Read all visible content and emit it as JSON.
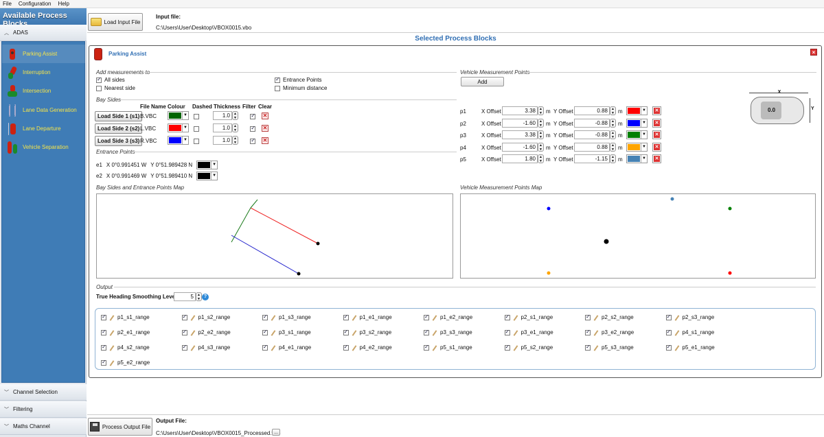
{
  "menu": [
    "File",
    "Configuration",
    "Help"
  ],
  "sidebar": {
    "title": "Available Process Blocks",
    "group_adas": "ADAS",
    "items": [
      {
        "label": "Parking Assist"
      },
      {
        "label": "Interruption"
      },
      {
        "label": "Intersection"
      },
      {
        "label": "Lane Data Generation"
      },
      {
        "label": "Lane Departure"
      },
      {
        "label": "Vehicle Separation"
      }
    ],
    "bottom_groups": [
      "Channel Selection",
      "Filtering",
      "Maths Channel"
    ]
  },
  "input": {
    "button": "Load Input File",
    "label": "Input file:",
    "path": "C:\\Users\\User\\Desktop\\VBOX0015.vbo"
  },
  "section_title": "Selected Process Blocks",
  "panel": {
    "title": "Parking Assist",
    "add_measurements": {
      "title": "Add measurements to",
      "all_sides": "All sides",
      "nearest_side": "Nearest side",
      "entrance_points": "Entrance Points",
      "minimum_distance": "Minimum distance"
    },
    "bay_sides": {
      "title": "Bay Sides",
      "headers": [
        "File Name",
        "Colour",
        "Dashed",
        "Thickness",
        "Filter",
        "Clear"
      ],
      "rows": [
        {
          "button": "Load Side 1 (s1)",
          "file": "B.VBC",
          "color": "#006400",
          "thickness": "1.0"
        },
        {
          "button": "Load Side 2 (s2)",
          "file": "L.VBC",
          "color": "#ff0000",
          "thickness": "1.0"
        },
        {
          "button": "Load Side 3 (s3)",
          "file": "R.VBC",
          "color": "#0000ff",
          "thickness": "1.0"
        }
      ]
    },
    "entrance_points": {
      "title": "Entrance Points",
      "rows": [
        {
          "id": "e1",
          "x": "X  0°0.991451 W",
          "y": "Y  0°51.989428 N",
          "color": "#000000"
        },
        {
          "id": "e2",
          "x": "X  0°0.991469 W",
          "y": "Y  0°51.989410 N",
          "color": "#000000"
        }
      ]
    },
    "vmp": {
      "title": "Vehicle Measurement Points",
      "add": "Add",
      "x_label": "X Offset",
      "y_label": "Y Offset",
      "unit": "m",
      "rows": [
        {
          "id": "p1",
          "x": "3.38",
          "y": "0.88",
          "color": "#ff0000"
        },
        {
          "id": "p2",
          "x": "-1.60",
          "y": "-0.88",
          "color": "#0000ff"
        },
        {
          "id": "p3",
          "x": "3.38",
          "y": "-0.88",
          "color": "#008000"
        },
        {
          "id": "p4",
          "x": "-1.60",
          "y": "0.88",
          "color": "#ffa500"
        },
        {
          "id": "p5",
          "x": "1.80",
          "y": "-1.15",
          "color": "#4682b4"
        }
      ],
      "car_label": "0.0",
      "axis_x": "X",
      "axis_y": "Y"
    },
    "bay_map_title": "Bay Sides and Entrance Points Map",
    "vmp_map_title": "Vehicle Measurement Points Map",
    "output": {
      "title": "Output",
      "smoothing_label": "True Heading Smoothing Level",
      "smoothing_value": "5",
      "channels": [
        "p1_s1_range",
        "p1_s2_range",
        "p1_s3_range",
        "p1_e1_range",
        "p1_e2_range",
        "p2_s1_range",
        "p2_s2_range",
        "p2_s3_range",
        "p2_e1_range",
        "p2_e2_range",
        "p3_s1_range",
        "p3_s2_range",
        "p3_s3_range",
        "p3_e1_range",
        "p3_e2_range",
        "p4_s1_range",
        "p4_s2_range",
        "p4_s3_range",
        "p4_e1_range",
        "p4_e2_range",
        "p5_s1_range",
        "p5_s2_range",
        "p5_s3_range",
        "p5_e1_range",
        "p5_e2_range"
      ]
    }
  },
  "output_file": {
    "button": "Process Output File",
    "label": "Output File:",
    "path": "C:\\Users\\User\\Desktop\\VBOX0015_Processed.vbo",
    "browse": "..."
  }
}
